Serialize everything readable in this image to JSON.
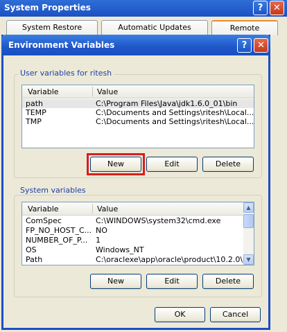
{
  "system_properties": {
    "title": "System Properties",
    "tabs": [
      "System Restore",
      "Automatic Updates",
      "Remote"
    ]
  },
  "dialog": {
    "title": "Environment Variables",
    "user_group_label": "User variables for ritesh",
    "system_group_label": "System variables",
    "columns": [
      "Variable",
      "Value"
    ],
    "user_vars": [
      {
        "name": "path",
        "value": "C:\\Program Files\\Java\\jdk1.6.0_01\\bin"
      },
      {
        "name": "TEMP",
        "value": "C:\\Documents and Settings\\ritesh\\Local..."
      },
      {
        "name": "TMP",
        "value": "C:\\Documents and Settings\\ritesh\\Local..."
      }
    ],
    "system_vars": [
      {
        "name": "ComSpec",
        "value": "C:\\WINDOWS\\system32\\cmd.exe"
      },
      {
        "name": "FP_NO_HOST_C...",
        "value": "NO"
      },
      {
        "name": "NUMBER_OF_P...",
        "value": "1"
      },
      {
        "name": "OS",
        "value": "Windows_NT"
      },
      {
        "name": "Path",
        "value": "C:\\oraclexe\\app\\oracle\\product\\10.2.0\\..."
      }
    ],
    "buttons": {
      "new": "New",
      "edit": "Edit",
      "delete": "Delete",
      "ok": "OK",
      "cancel": "Cancel"
    },
    "help_glyph": "?",
    "close_glyph": "✕"
  },
  "colors": {
    "highlight": "#d91d1d",
    "title_blue": "#1f56c9"
  }
}
